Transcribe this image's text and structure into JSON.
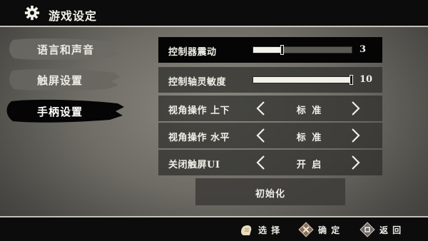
{
  "header": {
    "title": "游戏设定",
    "icon": "gear-icon"
  },
  "nav": {
    "items": [
      {
        "label": "语言和声音"
      },
      {
        "label": "触屏设置"
      },
      {
        "label": "手柄设置"
      }
    ],
    "active_index": 2
  },
  "settings": {
    "vibration": {
      "label": "控制器震动",
      "value": "3",
      "level": 0.3
    },
    "sensitivity": {
      "label": "控制轴灵敏度",
      "value": "10",
      "level": 1.0
    },
    "view_vertical": {
      "label": "视角操作 上下",
      "option": "标 准"
    },
    "view_horizontal": {
      "label": "视角操作 水平",
      "option": "标 准"
    },
    "close_touch_ui": {
      "label": "关闭触屏UI",
      "option": "开 启"
    }
  },
  "reset": {
    "label": "初始化"
  },
  "footer": {
    "select": {
      "label": "选 择",
      "icon": "stick-icon"
    },
    "confirm": {
      "label": "确 定",
      "icon": "cross-button-icon"
    },
    "back": {
      "label": "返 回",
      "icon": "back-button-icon"
    }
  },
  "colors": {
    "header_bg": "#0c0c0c",
    "text": "#f0efe8",
    "row_bg": "#2d2c29",
    "active_row_bg": "#050505"
  }
}
